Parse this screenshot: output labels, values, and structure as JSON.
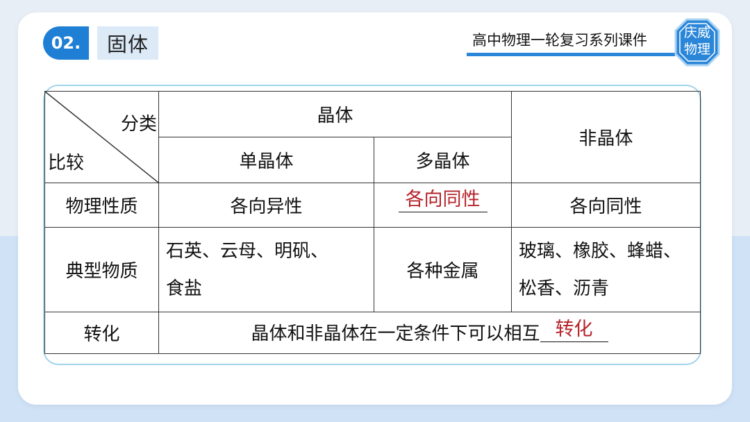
{
  "header": {
    "section_number": "02.",
    "section_title": "固体",
    "series_title": "高中物理一轮复习系列课件",
    "badge_line1": "庆威",
    "badge_line2": "物理"
  },
  "table": {
    "corner_top": "分类",
    "corner_bottom": "比较",
    "crystal": "晶体",
    "amorphous": "非晶体",
    "single_crystal": "单晶体",
    "poly_crystal": "多晶体",
    "rows": {
      "physical": {
        "label": "物理性质",
        "single": "各向异性",
        "poly_answer": "各向同性",
        "amorphous": "各向同性"
      },
      "typical": {
        "label": "典型物质",
        "single_line1": "石英、云母、明矾、",
        "single_line2": "食盐",
        "poly": "各种金属",
        "amorphous_line1": "玻璃、橡胶、蜂蜡、",
        "amorphous_line2": "松香、沥青"
      },
      "transform": {
        "label": "转化",
        "text": "晶体和非晶体在一定条件下可以相互",
        "answer": "转化"
      }
    }
  },
  "colors": {
    "accent_blue": "#1e7fd4",
    "answer_red": "#b4232a",
    "frame_cyan": "#9fd4ea"
  }
}
